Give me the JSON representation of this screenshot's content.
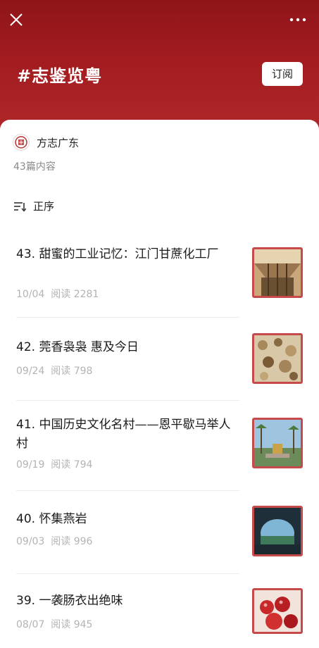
{
  "header": {
    "topic": "#志鉴览粤",
    "subscribe_label": "订阅",
    "close_icon": "close-icon",
    "more_icon": "more-icon"
  },
  "account": {
    "name": "方志广东",
    "article_count": "43篇内容"
  },
  "sort": {
    "label": "正序",
    "icon": "sort-icon"
  },
  "articles": [
    {
      "title": "43. 甜蜜的工业记忆：江门甘蔗化工厂",
      "date": "10/04",
      "reads": "阅读 2281"
    },
    {
      "title": "42. 莞香袅袅 惠及今日",
      "date": "09/24",
      "reads": "阅读 798"
    },
    {
      "title": "41. 中国历史文化名村——恩平歇马举人村",
      "date": "09/19",
      "reads": "阅读 794"
    },
    {
      "title": "40. 怀集燕岩",
      "date": "09/03",
      "reads": "阅读 996"
    },
    {
      "title": "39. 一袭肠衣出绝味",
      "date": "08/07",
      "reads": "阅读 945"
    }
  ],
  "colors": {
    "header_top": "#8f1519",
    "header_bottom": "#b02a2b",
    "thumb_border": "#c64a4a"
  }
}
